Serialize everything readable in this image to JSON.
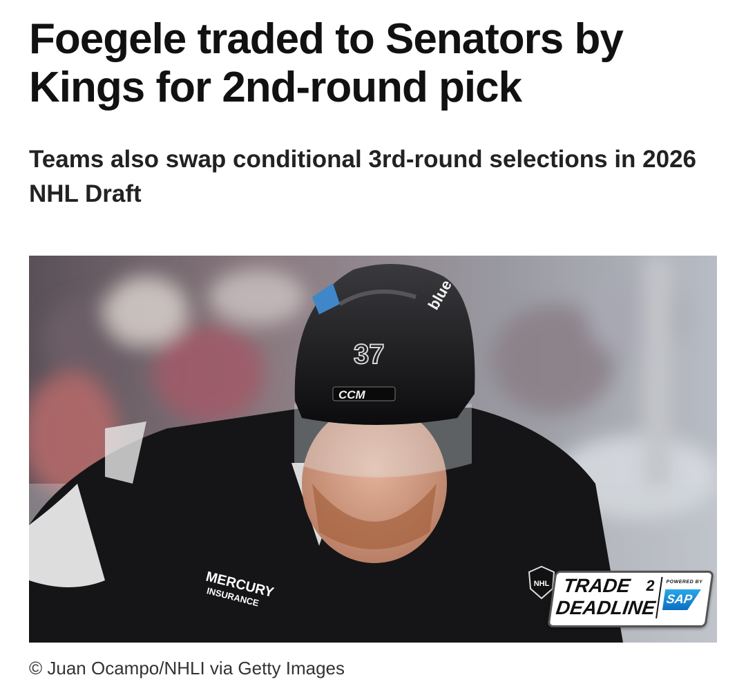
{
  "article": {
    "headline": "Foegele traded to Senators by Kings for 2nd-round pick",
    "subheadline": "Teams also swap conditional 3rd-round selections in 2026 NHL Draft",
    "photo_caption": "© Juan Ocampo/NHLI via Getty Images"
  },
  "photo": {
    "description_icon": "hockey-player-photo",
    "helmet_number": "37",
    "helmet_brand": "CCM",
    "helmet_sticker": "blue",
    "jersey_patch": "MERCURY INSURANCE",
    "badge": {
      "logo": "NHL",
      "line1": "TRADE",
      "line2": "DEADLINE",
      "mark": "2",
      "powered_by": "POWERED BY",
      "sponsor": "SAP"
    }
  },
  "colors": {
    "text": "#111111",
    "caption": "#333333",
    "background": "#ffffff"
  }
}
